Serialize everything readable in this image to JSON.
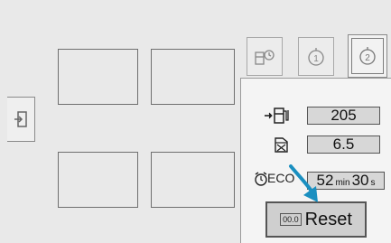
{
  "tabs": [
    {
      "name": "fuel-info",
      "icon": "fuel-trip-icon"
    },
    {
      "name": "trip-1",
      "icon": "trip-timer-1-icon"
    },
    {
      "name": "trip-2",
      "icon": "trip-timer-2-icon",
      "selected": true
    }
  ],
  "side_button": {
    "icon": "exit-icon"
  },
  "panel": {
    "range": {
      "icon": "fuel-range-icon",
      "value": "205"
    },
    "consumption": {
      "icon": "consumption-icon",
      "value": "6.5"
    },
    "eco": {
      "label": "ECO",
      "minutes": "52",
      "min_unit": "min",
      "seconds": "30",
      "sec_unit": "s"
    },
    "reset": {
      "chip": "00.0",
      "label": "Reset"
    }
  },
  "colors": {
    "pointer_arrow": "#1a8fc0",
    "panel_bg": "#f4f4f4",
    "value_bg": "#d7d7d7"
  }
}
